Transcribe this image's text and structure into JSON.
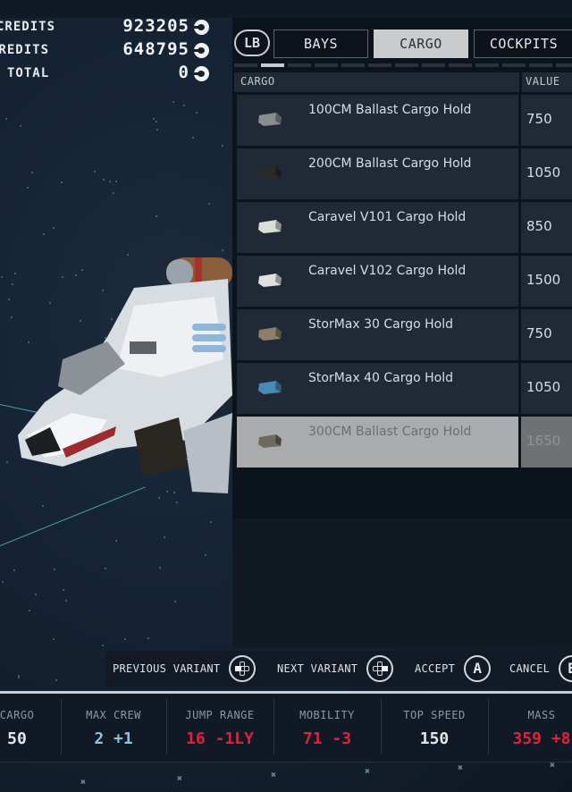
{
  "credits": {
    "rows": [
      {
        "label": "CREDITS",
        "value": "923205"
      },
      {
        "label": "CREDITS",
        "value": "648795"
      },
      {
        "label": "TOTAL",
        "value": "0"
      }
    ],
    "currency_icon": "credit-icon"
  },
  "tabs": {
    "prev_button": "LB",
    "items": [
      {
        "label": "BAYS",
        "active": false
      },
      {
        "label": "CARGO",
        "active": true
      },
      {
        "label": "COCKPITS",
        "active": false
      }
    ],
    "page_indicator": {
      "total_visible": 12,
      "active_index": 1
    }
  },
  "table": {
    "headers": {
      "name": "CARGO",
      "value": "VALUE"
    },
    "rows": [
      {
        "name": "100CM Ballast Cargo Hold",
        "value": "750",
        "thumb_color": "#8a8d90",
        "selected": false
      },
      {
        "name": "200CM Ballast Cargo Hold",
        "value": "1050",
        "thumb_color": "#2a2a2a",
        "selected": false
      },
      {
        "name": "Caravel V101 Cargo Hold",
        "value": "850",
        "thumb_color": "#d9dfd8",
        "selected": false
      },
      {
        "name": "Caravel V102 Cargo Hold",
        "value": "1500",
        "thumb_color": "#e0e0de",
        "selected": false
      },
      {
        "name": "StorMax 30 Cargo Hold",
        "value": "750",
        "thumb_color": "#8b7f6a",
        "selected": false
      },
      {
        "name": "StorMax 40 Cargo Hold",
        "value": "1050",
        "thumb_color": "#4a89b4",
        "selected": false
      },
      {
        "name": "300CM Ballast Cargo Hold",
        "value": "1650",
        "thumb_color": "#6e6a5e",
        "selected": true
      }
    ]
  },
  "actions": [
    {
      "label": "PREVIOUS VARIANT",
      "icon": "dpad-left-icon"
    },
    {
      "label": "NEXT VARIANT",
      "icon": "dpad-right-icon"
    },
    {
      "label": "ACCEPT",
      "icon": "a-button-icon",
      "glyph": "A"
    },
    {
      "label": "CANCEL",
      "icon": "b-button-icon",
      "glyph": "B"
    }
  ],
  "stats": [
    {
      "label": "CARGO",
      "value": "50",
      "color": "#e4e7ea"
    },
    {
      "label": "MAX CREW",
      "value": "2 +1",
      "color": "#8fc3dc"
    },
    {
      "label": "JUMP RANGE",
      "value": "16 -1LY",
      "color": "#e0213e"
    },
    {
      "label": "MOBILITY",
      "value": "71 -3",
      "color": "#e0213e"
    },
    {
      "label": "TOP SPEED",
      "value": "150",
      "color": "#e4e7ea"
    },
    {
      "label": "MASS",
      "value": "359 +8",
      "color": "#e0213e"
    }
  ]
}
